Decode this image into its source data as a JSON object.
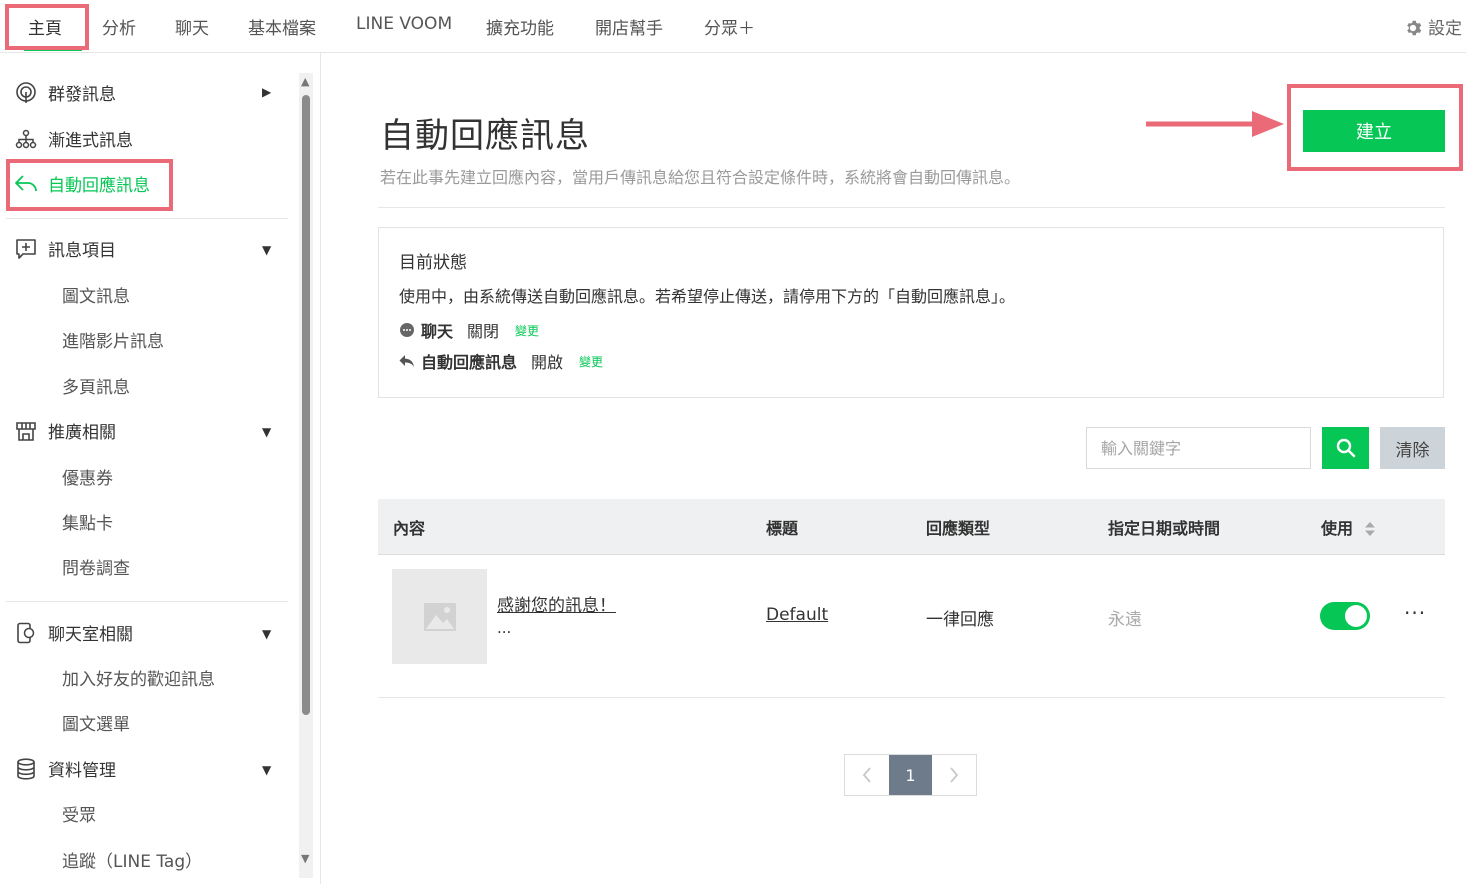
{
  "topnav": {
    "items": [
      "主頁",
      "分析",
      "聊天",
      "基本檔案",
      "LINE VOOM",
      "擴充功能",
      "開店幫手",
      "分眾＋"
    ],
    "settings_label": "設定"
  },
  "sidebar": {
    "broadcast": "群發訊息",
    "stepmsg": "漸進式訊息",
    "autoreply": "自動回應訊息",
    "msgitems": "訊息項目",
    "msgitems_sub": [
      "圖文訊息",
      "進階影片訊息",
      "多頁訊息"
    ],
    "promo": "推廣相關",
    "promo_sub": [
      "優惠券",
      "集點卡",
      "問卷調查"
    ],
    "chatroom": "聊天室相關",
    "chatroom_sub": [
      "加入好友的歡迎訊息",
      "圖文選單"
    ],
    "data": "資料管理",
    "data_sub": [
      "受眾",
      "追蹤（LINE Tag）"
    ]
  },
  "main": {
    "title": "自動回應訊息",
    "description": "若在此事先建立回應內容，當用戶傳訊息給您且符合設定條件時，系統將會自動回傳訊息。",
    "create_label": "建立",
    "status": {
      "title": "目前狀態",
      "text": "使用中，由系統傳送自動回應訊息。若希望停止傳送，請停用下方的「自動回應訊息」。",
      "chat_label": "聊天",
      "chat_value": "關閉",
      "autoreply_label": "自動回應訊息",
      "autoreply_value": "開啟",
      "change_label": "變更"
    },
    "search": {
      "placeholder": "輸入關鍵字",
      "clear_label": "清除"
    },
    "table": {
      "headers": [
        "內容",
        "標題",
        "回應類型",
        "指定日期或時間",
        "使用"
      ],
      "rows": [
        {
          "content": "感謝您的訊息！",
          "content_more": "...",
          "title": "Default",
          "type": "一律回應",
          "date": "永遠",
          "enabled": true
        }
      ]
    },
    "pagination": {
      "current": "1"
    }
  },
  "colors": {
    "accent": "#06c755",
    "highlight": "#ea6b77"
  }
}
